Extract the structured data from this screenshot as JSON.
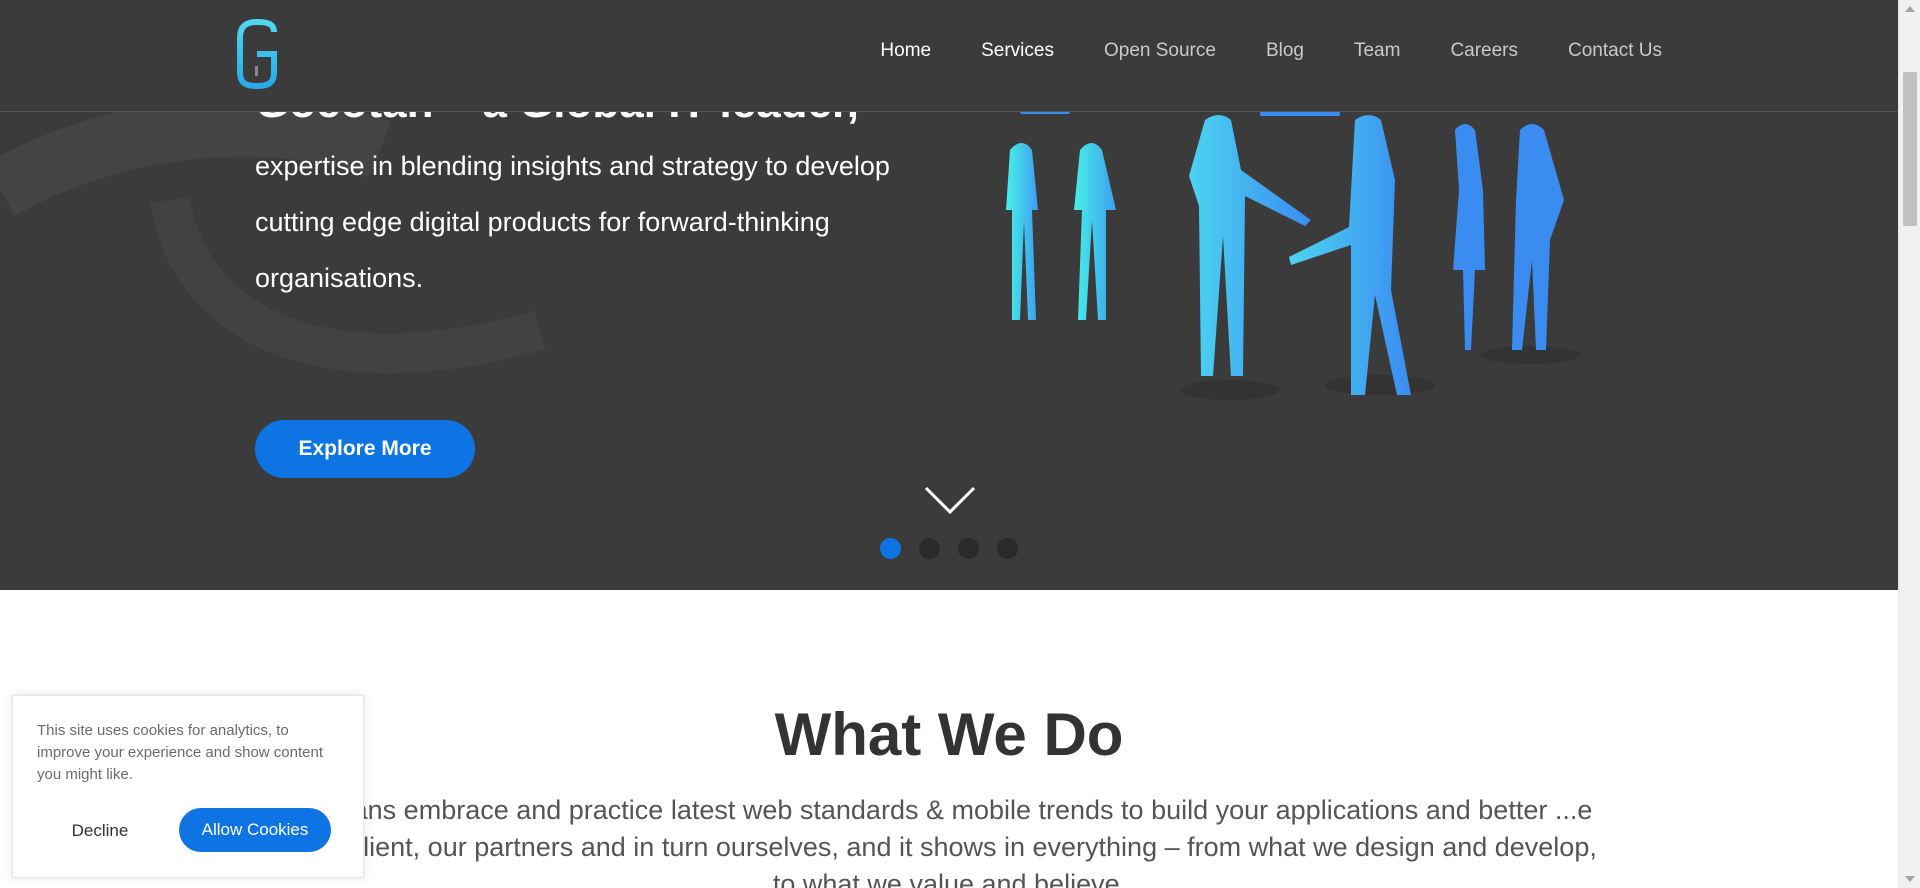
{
  "nav": {
    "items": [
      {
        "label": "Home"
      },
      {
        "label": "Services"
      },
      {
        "label": "Open Source"
      },
      {
        "label": "Blog"
      },
      {
        "label": "Team"
      },
      {
        "label": "Careers"
      },
      {
        "label": "Contact Us"
      }
    ]
  },
  "hero": {
    "heading": "Gocotan – a Global IT leader,",
    "text": "expertise in blending insights and strategy to develop cutting edge digital products for forward-thinking organisations.",
    "cta_label": "Explore More",
    "slides_count": 4,
    "active_slide": 1
  },
  "what_we_do": {
    "title": "What We Do",
    "text": "...ptans embrace and practice latest web standards & mobile trends to build your applications and better ...e our client, our partners and in turn ourselves, and it shows in everything – from what we design and develop, to what we value and believe."
  },
  "cookie": {
    "message": "This site uses cookies for analytics, to improve your experience and show content you might like.",
    "decline_label": "Decline",
    "allow_label": "Allow Cookies"
  },
  "colors": {
    "accent": "#0f74e3",
    "hero_bg": "#3b3b3b",
    "logo_gradient": [
      "#4fd8f0",
      "#2aa8e8"
    ]
  }
}
